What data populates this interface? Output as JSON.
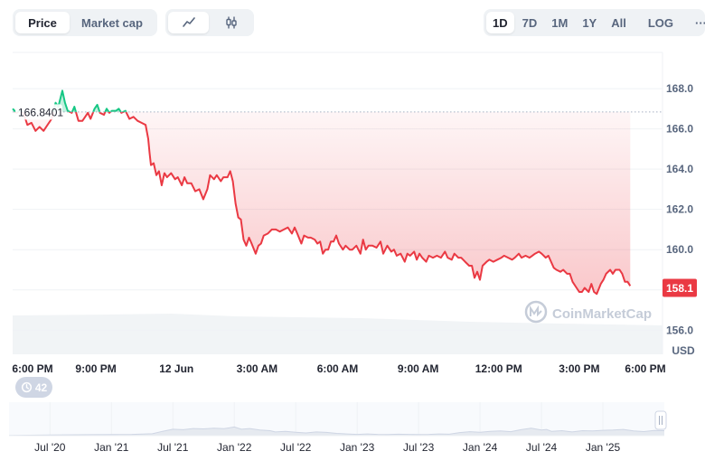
{
  "controls": {
    "type_tabs": [
      {
        "label": "Price",
        "active": true
      },
      {
        "label": "Market cap",
        "active": false
      }
    ],
    "style_icons": [
      "line-chart-icon",
      "candlestick-icon"
    ],
    "ranges": [
      {
        "label": "1D",
        "active": true
      },
      {
        "label": "7D",
        "active": false
      },
      {
        "label": "1M",
        "active": false
      },
      {
        "label": "1Y",
        "active": false
      },
      {
        "label": "All",
        "active": false
      }
    ],
    "log_label": "LOG",
    "more_label": "···"
  },
  "chart_data": {
    "type": "line",
    "ylabel": "USD",
    "ylim": [
      154.8,
      169.8
    ],
    "yticks": [
      "168.0",
      "166.0",
      "164.0",
      "162.0",
      "160.0",
      "158.0",
      "156.0"
    ],
    "ytick_values": [
      168.0,
      166.0,
      164.0,
      162.0,
      160.0,
      158.0,
      156.0
    ],
    "xticks": [
      "6:00 PM",
      "9:00 PM",
      "12 Jun",
      "3:00 AM",
      "6:00 AM",
      "9:00 AM",
      "12:00 PM",
      "3:00 PM",
      "6:00 PM"
    ],
    "xtick_hours": [
      0,
      3,
      6,
      9,
      12,
      15,
      18,
      21,
      24
    ],
    "x_range_hours": [
      -0.1,
      24.1
    ],
    "reference_label": "166.8401",
    "reference_value": 166.8401,
    "current_label": "158.1",
    "current_value": 158.1,
    "watermark": "CoinMarketCap",
    "colors": {
      "up": "#16c784",
      "down": "#ea3943",
      "grid": "#eff2f5",
      "text": "#222531",
      "axis_text": "#58667e"
    },
    "series": [
      {
        "points": [
          [
            -0.1,
            167.0
          ],
          [
            0.05,
            166.8
          ],
          [
            0.15,
            166.9
          ],
          [
            0.3,
            166.8
          ],
          [
            0.45,
            166.2
          ],
          [
            0.6,
            166.3
          ],
          [
            0.75,
            165.9
          ],
          [
            0.9,
            166.1
          ],
          [
            1.05,
            165.9
          ],
          [
            1.2,
            166.2
          ],
          [
            1.35,
            166.5
          ],
          [
            1.5,
            167.3
          ],
          [
            1.6,
            167.1
          ],
          [
            1.75,
            167.9
          ],
          [
            1.85,
            167.3
          ],
          [
            1.95,
            166.9
          ],
          [
            2.1,
            166.8
          ],
          [
            2.2,
            167.1
          ],
          [
            2.35,
            166.4
          ],
          [
            2.5,
            166.4
          ],
          [
            2.6,
            166.6
          ],
          [
            2.7,
            166.8
          ],
          [
            2.8,
            166.5
          ],
          [
            2.95,
            167.0
          ],
          [
            3.05,
            167.2
          ],
          [
            3.15,
            166.8
          ],
          [
            3.3,
            166.7
          ],
          [
            3.4,
            167.0
          ],
          [
            3.5,
            166.8
          ],
          [
            3.6,
            166.9
          ],
          [
            3.75,
            166.9
          ],
          [
            3.85,
            167.0
          ],
          [
            3.95,
            166.8
          ],
          [
            4.1,
            166.9
          ],
          [
            4.25,
            166.5
          ],
          [
            4.4,
            166.6
          ],
          [
            4.55,
            166.4
          ],
          [
            4.7,
            166.3
          ],
          [
            4.85,
            166.2
          ],
          [
            4.95,
            165.5
          ],
          [
            5.0,
            164.8
          ],
          [
            5.05,
            164.2
          ],
          [
            5.15,
            164.3
          ],
          [
            5.25,
            163.7
          ],
          [
            5.35,
            163.9
          ],
          [
            5.45,
            163.2
          ],
          [
            5.55,
            163.8
          ],
          [
            5.65,
            163.6
          ],
          [
            5.8,
            163.8
          ],
          [
            5.95,
            163.5
          ],
          [
            6.05,
            163.6
          ],
          [
            6.2,
            163.2
          ],
          [
            6.3,
            163.6
          ],
          [
            6.4,
            163.3
          ],
          [
            6.55,
            163.3
          ],
          [
            6.7,
            162.9
          ],
          [
            6.85,
            163.0
          ],
          [
            7.0,
            162.5
          ],
          [
            7.15,
            163.0
          ],
          [
            7.25,
            163.7
          ],
          [
            7.4,
            163.5
          ],
          [
            7.5,
            163.7
          ],
          [
            7.65,
            163.4
          ],
          [
            7.75,
            163.6
          ],
          [
            7.9,
            163.6
          ],
          [
            8.0,
            163.9
          ],
          [
            8.1,
            163.4
          ],
          [
            8.2,
            162.3
          ],
          [
            8.3,
            161.6
          ],
          [
            8.4,
            161.5
          ],
          [
            8.5,
            160.5
          ],
          [
            8.6,
            160.2
          ],
          [
            8.7,
            160.6
          ],
          [
            8.8,
            160.3
          ],
          [
            8.95,
            159.8
          ],
          [
            9.05,
            160.2
          ],
          [
            9.15,
            160.3
          ],
          [
            9.25,
            160.7
          ],
          [
            9.4,
            160.8
          ],
          [
            9.55,
            161.0
          ],
          [
            9.7,
            161.0
          ],
          [
            9.85,
            160.9
          ],
          [
            10.0,
            161.0
          ],
          [
            10.15,
            161.1
          ],
          [
            10.3,
            160.8
          ],
          [
            10.4,
            161.1
          ],
          [
            10.5,
            160.8
          ],
          [
            10.65,
            160.3
          ],
          [
            10.75,
            160.7
          ],
          [
            10.9,
            160.6
          ],
          [
            11.0,
            160.6
          ],
          [
            11.15,
            160.5
          ],
          [
            11.25,
            160.3
          ],
          [
            11.35,
            160.4
          ],
          [
            11.45,
            159.8
          ],
          [
            11.55,
            160.0
          ],
          [
            11.65,
            160.0
          ],
          [
            11.75,
            160.4
          ],
          [
            11.85,
            160.4
          ],
          [
            11.95,
            160.7
          ],
          [
            12.05,
            160.3
          ],
          [
            12.2,
            160.0
          ],
          [
            12.3,
            160.2
          ],
          [
            12.45,
            160.0
          ],
          [
            12.55,
            160.0
          ],
          [
            12.7,
            160.2
          ],
          [
            12.85,
            159.8
          ],
          [
            12.95,
            160.5
          ],
          [
            13.05,
            160.0
          ],
          [
            13.15,
            160.2
          ],
          [
            13.3,
            160.2
          ],
          [
            13.45,
            160.1
          ],
          [
            13.6,
            160.4
          ],
          [
            13.7,
            159.8
          ],
          [
            13.85,
            160.2
          ],
          [
            14.0,
            159.9
          ],
          [
            14.1,
            160.0
          ],
          [
            14.2,
            159.7
          ],
          [
            14.35,
            159.8
          ],
          [
            14.5,
            159.4
          ],
          [
            14.6,
            159.8
          ],
          [
            14.7,
            159.7
          ],
          [
            14.85,
            159.9
          ],
          [
            14.95,
            159.5
          ],
          [
            15.05,
            159.8
          ],
          [
            15.15,
            159.6
          ],
          [
            15.3,
            159.4
          ],
          [
            15.4,
            159.7
          ],
          [
            15.55,
            159.6
          ],
          [
            15.7,
            159.7
          ],
          [
            15.85,
            159.6
          ],
          [
            16.0,
            159.9
          ],
          [
            16.1,
            159.6
          ],
          [
            16.25,
            159.5
          ],
          [
            16.35,
            159.8
          ],
          [
            16.5,
            159.6
          ],
          [
            16.6,
            159.6
          ],
          [
            16.75,
            159.4
          ],
          [
            16.9,
            159.2
          ],
          [
            17.0,
            159.2
          ],
          [
            17.1,
            158.6
          ],
          [
            17.2,
            158.9
          ],
          [
            17.3,
            158.5
          ],
          [
            17.4,
            159.2
          ],
          [
            17.55,
            159.4
          ],
          [
            17.65,
            159.5
          ],
          [
            17.8,
            159.4
          ],
          [
            17.95,
            159.5
          ],
          [
            18.1,
            159.6
          ],
          [
            18.2,
            159.7
          ],
          [
            18.35,
            159.6
          ],
          [
            18.5,
            159.5
          ],
          [
            18.6,
            159.6
          ],
          [
            18.75,
            159.8
          ],
          [
            18.85,
            159.6
          ],
          [
            19.0,
            159.7
          ],
          [
            19.15,
            159.6
          ],
          [
            19.25,
            159.7
          ],
          [
            19.35,
            159.8
          ],
          [
            19.5,
            159.9
          ],
          [
            19.6,
            159.8
          ],
          [
            19.75,
            159.6
          ],
          [
            19.85,
            159.7
          ],
          [
            19.95,
            159.4
          ],
          [
            20.05,
            159.1
          ],
          [
            20.15,
            159.0
          ],
          [
            20.3,
            158.9
          ],
          [
            20.4,
            159.0
          ],
          [
            20.55,
            158.8
          ],
          [
            20.65,
            158.8
          ],
          [
            20.75,
            158.4
          ],
          [
            20.9,
            158.1
          ],
          [
            21.0,
            157.9
          ],
          [
            21.1,
            157.9
          ],
          [
            21.2,
            158.1
          ],
          [
            21.35,
            157.9
          ],
          [
            21.45,
            158.3
          ],
          [
            21.55,
            157.9
          ],
          [
            21.65,
            157.8
          ],
          [
            21.8,
            158.3
          ],
          [
            21.9,
            158.5
          ],
          [
            22.0,
            158.8
          ],
          [
            22.15,
            159.0
          ],
          [
            22.25,
            158.8
          ],
          [
            22.35,
            159.0
          ],
          [
            22.5,
            159.0
          ],
          [
            22.6,
            158.8
          ],
          [
            22.7,
            158.4
          ],
          [
            22.8,
            158.4
          ],
          [
            22.9,
            158.2
          ]
        ]
      }
    ],
    "navigator": {
      "xticks": [
        "Jul '20",
        "Jan '21",
        "Jul '21",
        "Jan '22",
        "Jul '22",
        "Jan '23",
        "Jul '23",
        "Jan '24",
        "Jul '24",
        "Jan '25"
      ],
      "xtick_months": [
        0,
        6,
        12,
        18,
        24,
        30,
        36,
        42,
        48,
        54
      ],
      "x_range_months": [
        -4,
        60
      ],
      "ylim": [
        0,
        270
      ],
      "points": [
        [
          -4,
          2
        ],
        [
          0,
          5
        ],
        [
          4,
          8
        ],
        [
          8,
          10
        ],
        [
          10,
          15
        ],
        [
          11,
          35
        ],
        [
          12,
          52
        ],
        [
          13,
          48
        ],
        [
          14,
          58
        ],
        [
          15,
          55
        ],
        [
          16,
          60
        ],
        [
          17,
          57
        ],
        [
          18,
          70
        ],
        [
          18.7,
          52
        ],
        [
          19.5,
          58
        ],
        [
          20.5,
          45
        ],
        [
          21.5,
          40
        ],
        [
          22,
          30
        ],
        [
          23,
          35
        ],
        [
          24,
          28
        ],
        [
          25,
          22
        ],
        [
          26,
          30
        ],
        [
          27,
          26
        ],
        [
          28,
          18
        ],
        [
          29,
          14
        ],
        [
          30,
          10
        ],
        [
          31,
          14
        ],
        [
          32,
          10
        ],
        [
          33,
          9
        ],
        [
          34,
          12
        ],
        [
          35,
          10
        ],
        [
          36,
          9
        ],
        [
          37,
          10
        ],
        [
          38,
          14
        ],
        [
          39,
          12
        ],
        [
          40,
          25
        ],
        [
          41,
          32
        ],
        [
          42,
          27
        ],
        [
          43,
          35
        ],
        [
          44,
          38
        ],
        [
          45,
          32
        ],
        [
          46,
          48
        ],
        [
          47,
          60
        ],
        [
          48,
          45
        ],
        [
          48.5,
          50
        ],
        [
          49,
          34
        ],
        [
          50,
          40
        ],
        [
          51,
          30
        ],
        [
          52,
          40
        ],
        [
          53,
          38
        ],
        [
          54,
          43
        ],
        [
          55,
          45
        ],
        [
          56,
          50
        ],
        [
          57,
          38
        ],
        [
          58,
          33
        ],
        [
          59,
          42
        ],
        [
          60,
          40
        ]
      ]
    }
  }
}
